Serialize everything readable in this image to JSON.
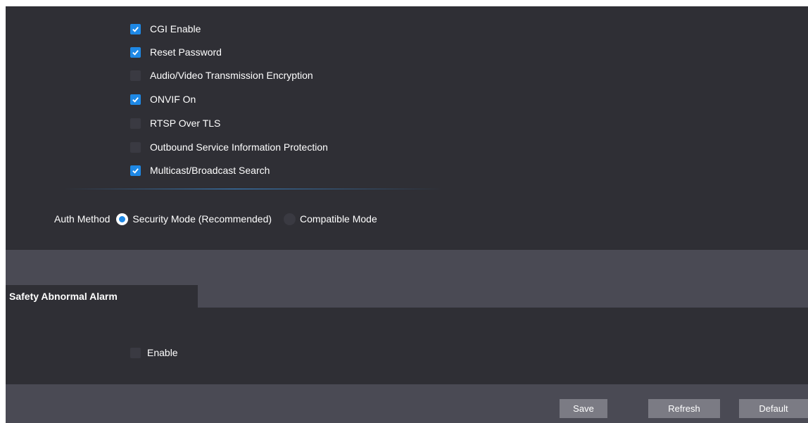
{
  "options": [
    {
      "label": "CGI Enable",
      "checked": true
    },
    {
      "label": "Reset Password",
      "checked": true
    },
    {
      "label": "Audio/Video Transmission Encryption",
      "checked": false
    },
    {
      "label": "ONVIF On",
      "checked": true
    },
    {
      "label": "RTSP Over TLS",
      "checked": false
    },
    {
      "label": "Outbound Service Information Protection",
      "checked": false
    },
    {
      "label": "Multicast/Broadcast Search",
      "checked": true
    }
  ],
  "auth": {
    "label": "Auth Method",
    "options": [
      {
        "label": "Security Mode (Recommended)",
        "selected": true
      },
      {
        "label": "Compatible Mode",
        "selected": false
      }
    ]
  },
  "alarm": {
    "tab_label": "Safety Abnormal Alarm",
    "enable_label": "Enable",
    "enable_checked": false
  },
  "buttons": {
    "save": "Save",
    "refresh": "Refresh",
    "default": "Default"
  },
  "colors": {
    "panel": "#2f2f35",
    "band": "#4a4a54",
    "accent": "#1e88e5",
    "button": "#7b7b84"
  }
}
